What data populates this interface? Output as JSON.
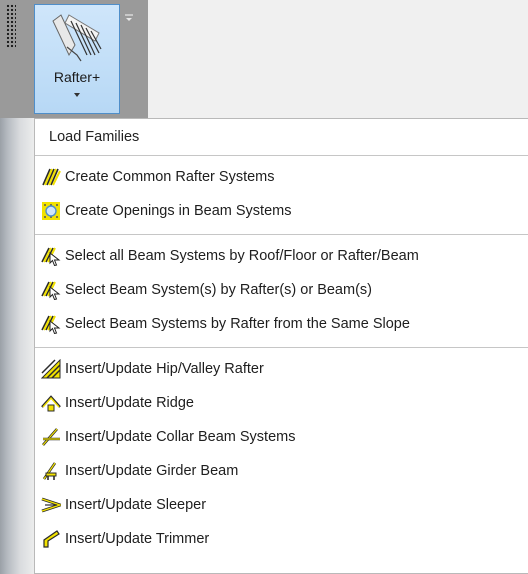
{
  "ribbon": {
    "button_label": "Rafter+",
    "icon": "rafter-icon",
    "accent": "#4f8ec9"
  },
  "menu": {
    "header": "Load Families",
    "groups": [
      {
        "items": [
          {
            "label": "Create Common Rafter Systems",
            "icon": "common-rafter-icon"
          },
          {
            "label": "Create Openings in Beam Systems",
            "icon": "opening-icon"
          }
        ]
      },
      {
        "items": [
          {
            "label": "Select all Beam Systems by Roof/Floor or Rafter/Beam",
            "icon": "select-cursor-icon"
          },
          {
            "label": "Select Beam System(s) by Rafter(s) or Beam(s)",
            "icon": "select-cursor-icon"
          },
          {
            "label": "Select Beam Systems by Rafter from the Same Slope",
            "icon": "select-cursor-icon"
          }
        ]
      },
      {
        "items": [
          {
            "label": "Insert/Update Hip/Valley Rafter",
            "icon": "hip-valley-icon"
          },
          {
            "label": "Insert/Update Ridge",
            "icon": "ridge-icon"
          },
          {
            "label": "Insert/Update Collar Beam Systems",
            "icon": "collar-beam-icon"
          },
          {
            "label": "Insert/Update Girder Beam",
            "icon": "girder-icon"
          },
          {
            "label": "Insert/Update Sleeper",
            "icon": "sleeper-icon"
          },
          {
            "label": "Insert/Update Trimmer",
            "icon": "trimmer-icon"
          }
        ]
      }
    ]
  },
  "colors": {
    "icon_yellow": "#f2e200",
    "icon_dark": "#2b2b2b"
  }
}
